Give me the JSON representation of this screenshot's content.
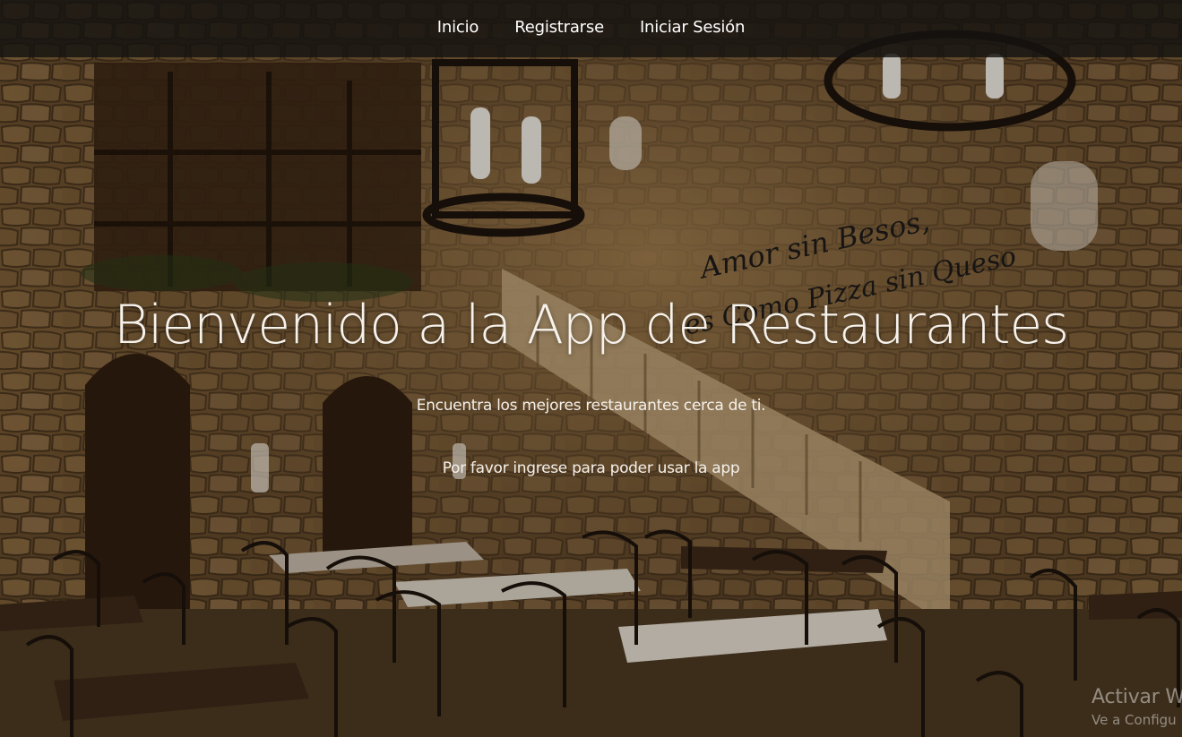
{
  "nav": {
    "items": [
      {
        "label": "Inicio"
      },
      {
        "label": "Registrarse"
      },
      {
        "label": "Iniciar Sesión"
      }
    ]
  },
  "hero": {
    "title": "Bienvenido a la App de Restaurantes",
    "subtitle": "Encuentra los mejores restaurantes cerca de ti.",
    "note": "Por favor ingrese para poder usar la app"
  },
  "background": {
    "wall_sign_line1": "Amor sin Besos,",
    "wall_sign_line2": "es Como Pizza sin Queso"
  },
  "os_watermark": {
    "title": "Activar W",
    "subtitle": "Ve a Configu"
  },
  "colors": {
    "navbar": "#141210",
    "text": "#ffffff",
    "stone": "#8a6a3e"
  }
}
